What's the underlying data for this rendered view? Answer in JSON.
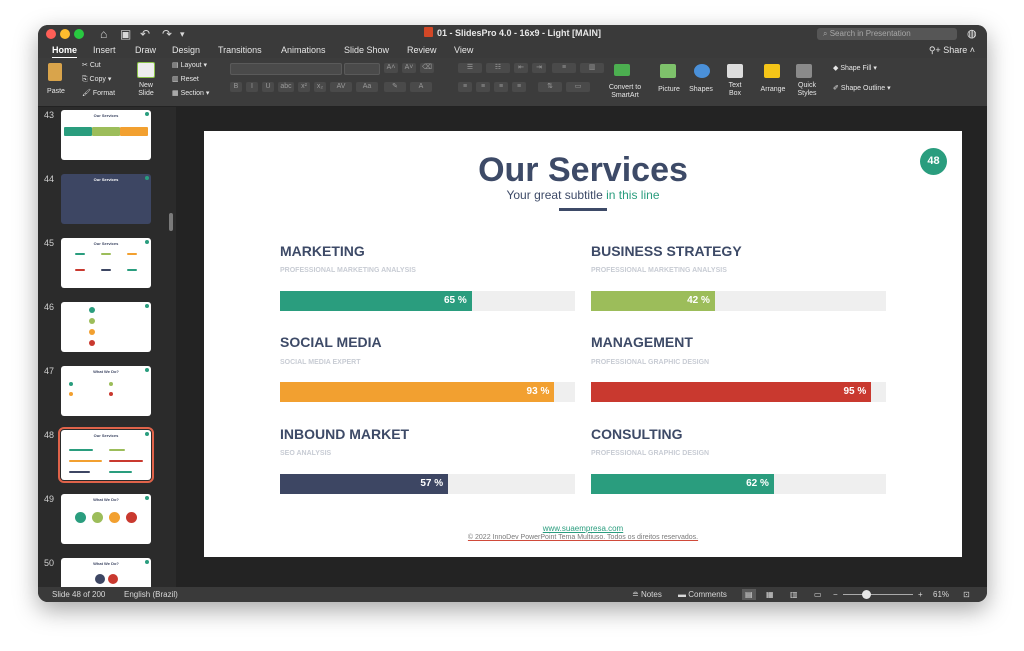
{
  "window": {
    "title": "01 - SlidesPro 4.0 - 16x9 - Light [MAIN]",
    "search_placeholder": "Search in Presentation",
    "share_label": "Share"
  },
  "tabs": [
    "Home",
    "Insert",
    "Draw",
    "Design",
    "Transitions",
    "Animations",
    "Slide Show",
    "Review",
    "View"
  ],
  "ribbon": {
    "paste": "Paste",
    "cut": "Cut",
    "copy": "Copy",
    "format": "Format",
    "new_slide_1": "New",
    "new_slide_2": "Slide",
    "layout": "Layout",
    "reset": "Reset",
    "section": "Section",
    "convert_1": "Convert to",
    "convert_2": "SmartArt",
    "picture": "Picture",
    "shapes": "Shapes",
    "textbox_1": "Text",
    "textbox_2": "Box",
    "arrange": "Arrange",
    "quick_styles_1": "Quick",
    "quick_styles_2": "Styles",
    "shape_fill": "Shape Fill",
    "shape_outline": "Shape Outline"
  },
  "thumbnails": [
    {
      "num": "43",
      "title": "Our Services"
    },
    {
      "num": "44",
      "title": "Our Services"
    },
    {
      "num": "45",
      "title": "Our Services"
    },
    {
      "num": "46",
      "title": ""
    },
    {
      "num": "47",
      "title": "What We Do?"
    },
    {
      "num": "48",
      "title": "Our Services"
    },
    {
      "num": "49",
      "title": "What We Do?"
    },
    {
      "num": "50",
      "title": "What We Do?"
    }
  ],
  "slide": {
    "title": "Our Services",
    "subtitle_main": "Your great subtitle",
    "subtitle_highlight": "in this line",
    "badge": "48",
    "services": [
      {
        "name": "MARKETING",
        "desc": "PROFESSIONAL MARKETING ANALYSIS",
        "percent": 65,
        "label": "65 %",
        "color": "#2a9d7e"
      },
      {
        "name": "BUSINESS STRATEGY",
        "desc": "PROFESSIONAL MARKETING ANALYSIS",
        "percent": 42,
        "label": "42 %",
        "color": "#9cbd5a"
      },
      {
        "name": "SOCIAL MEDIA",
        "desc": "SOCIAL MEDIA EXPERT",
        "percent": 93,
        "label": "93 %",
        "color": "#f2a030"
      },
      {
        "name": "MANAGEMENT",
        "desc": "PROFESSIONAL GRAPHIC DESIGN",
        "percent": 95,
        "label": "95 %",
        "color": "#c9392f"
      },
      {
        "name": "INBOUND MARKET",
        "desc": "SEO ANALYSIS",
        "percent": 57,
        "label": "57 %",
        "color": "#3d4663"
      },
      {
        "name": "CONSULTING",
        "desc": "PROFESSIONAL GRAPHIC DESIGN",
        "percent": 62,
        "label": "62 %",
        "color": "#2a9d7e"
      }
    ],
    "footer_link": "www.suaempresa.com",
    "footer_copy": "© 2022 InnoDev PowerPoint Tema Multiuso. Todos os direitos reservados."
  },
  "status": {
    "slide_info": "Slide 48 of 200",
    "language": "English (Brazil)",
    "notes": "Notes",
    "comments": "Comments",
    "zoom": "61%"
  }
}
